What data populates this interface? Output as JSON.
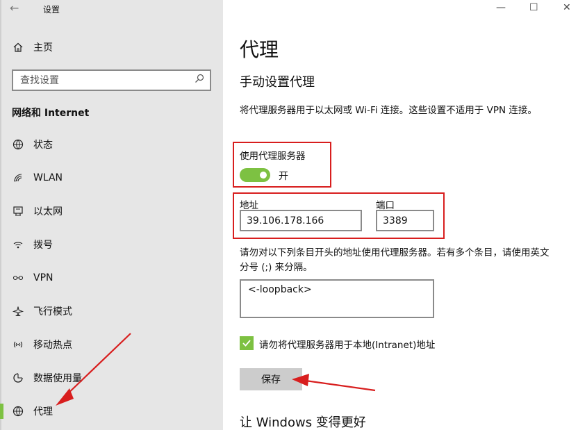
{
  "window": {
    "title": "设置",
    "back_icon": "←",
    "minimize_icon": "—",
    "maximize_icon": "☐",
    "close_icon": "✕"
  },
  "sidebar": {
    "home": {
      "label": "主页",
      "icon": "home-icon"
    },
    "search": {
      "placeholder": "查找设置",
      "icon": "search-icon"
    },
    "section_title": "网络和 Internet",
    "items": [
      {
        "label": "状态",
        "icon": "globe-status-icon"
      },
      {
        "label": "WLAN",
        "icon": "wifi-icon"
      },
      {
        "label": "以太网",
        "icon": "ethernet-icon"
      },
      {
        "label": "拨号",
        "icon": "dialup-icon"
      },
      {
        "label": "VPN",
        "icon": "vpn-icon"
      },
      {
        "label": "飞行模式",
        "icon": "airplane-icon"
      },
      {
        "label": "移动热点",
        "icon": "hotspot-icon"
      },
      {
        "label": "数据使用量",
        "icon": "data-usage-icon"
      },
      {
        "label": "代理",
        "icon": "globe-icon",
        "active": true
      }
    ]
  },
  "main": {
    "title": "代理",
    "section_title": "手动设置代理",
    "description": "将代理服务器用于以太网或 Wi-Fi 连接。这些设置不适用于 VPN 连接。",
    "use_proxy": {
      "label": "使用代理服务器",
      "state_text": "开",
      "on": true
    },
    "address": {
      "label": "地址",
      "value": "39.106.178.166"
    },
    "port": {
      "label": "端口",
      "value": "3389"
    },
    "exceptions": {
      "description": "请勿对以下列条目开头的地址使用代理服务器。若有多个条目，请使用英文分号 (;) 来分隔。",
      "value": "<-loopback>"
    },
    "bypass_local": {
      "label": "请勿将代理服务器用于本地(Intranet)地址",
      "checked": true
    },
    "save_label": "保存",
    "next_section_title": "让 Windows 变得更好"
  },
  "colors": {
    "accent": "#7dc142",
    "annotation": "#d81e1e",
    "sidebar_bg": "#e6e6e6"
  }
}
